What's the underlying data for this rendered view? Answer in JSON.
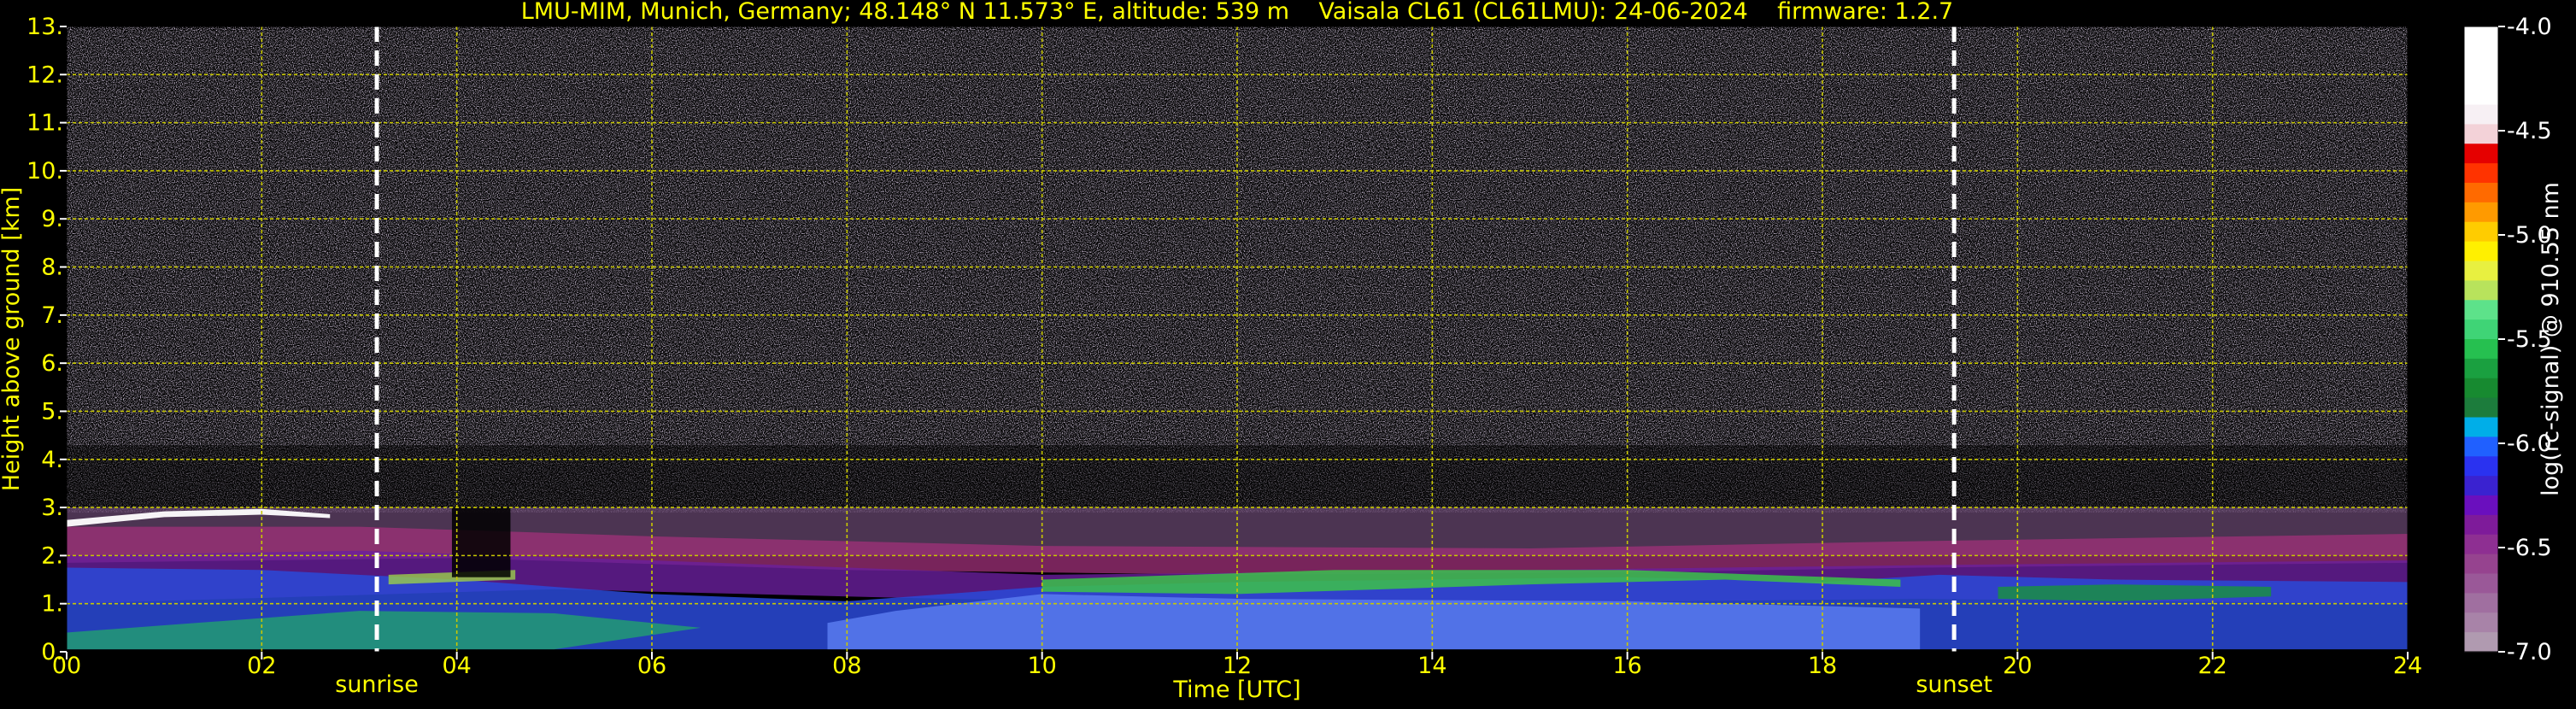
{
  "chart_data": {
    "type": "heatmap",
    "title": "LMU-MIM, Munich, Germany; 48.148° N 11.573° E, altitude: 539 m    Vaisala CL61 (CL61LMU): 24-06-2024    firmware: 1.2.7",
    "xlabel": "Time [UTC]",
    "ylabel": "Height above ground [km]",
    "xlim": [
      0,
      24
    ],
    "ylim": [
      0,
      13
    ],
    "x_ticks": [
      "00",
      "02",
      "04",
      "06",
      "08",
      "10",
      "12",
      "14",
      "16",
      "18",
      "20",
      "22",
      "24"
    ],
    "y_ticks": [
      "0.",
      "1.",
      "2.",
      "3.",
      "4.",
      "5.",
      "6.",
      "7.",
      "8.",
      "9.",
      "10.",
      "11.",
      "12.",
      "13."
    ],
    "grid": true,
    "colorbar": {
      "label": "log(rc-signal) @ 910.55 nm",
      "range": [
        -7.0,
        -4.0
      ],
      "ticks": [
        "-4.0",
        "-4.5",
        "-5.0",
        "-5.5",
        "-6.0",
        "-6.5",
        "-7.0"
      ],
      "tick_values": [
        -4.0,
        -4.5,
        -5.0,
        -5.5,
        -6.0,
        -6.5,
        -7.0
      ]
    },
    "annotations": [
      {
        "label": "sunrise",
        "x": 3.18
      },
      {
        "label": "sunset",
        "x": 19.35
      }
    ]
  },
  "colors": {
    "text": "#ffff00",
    "background": "#000000",
    "grid": "#c8c800",
    "event_line": "#ffffff"
  }
}
